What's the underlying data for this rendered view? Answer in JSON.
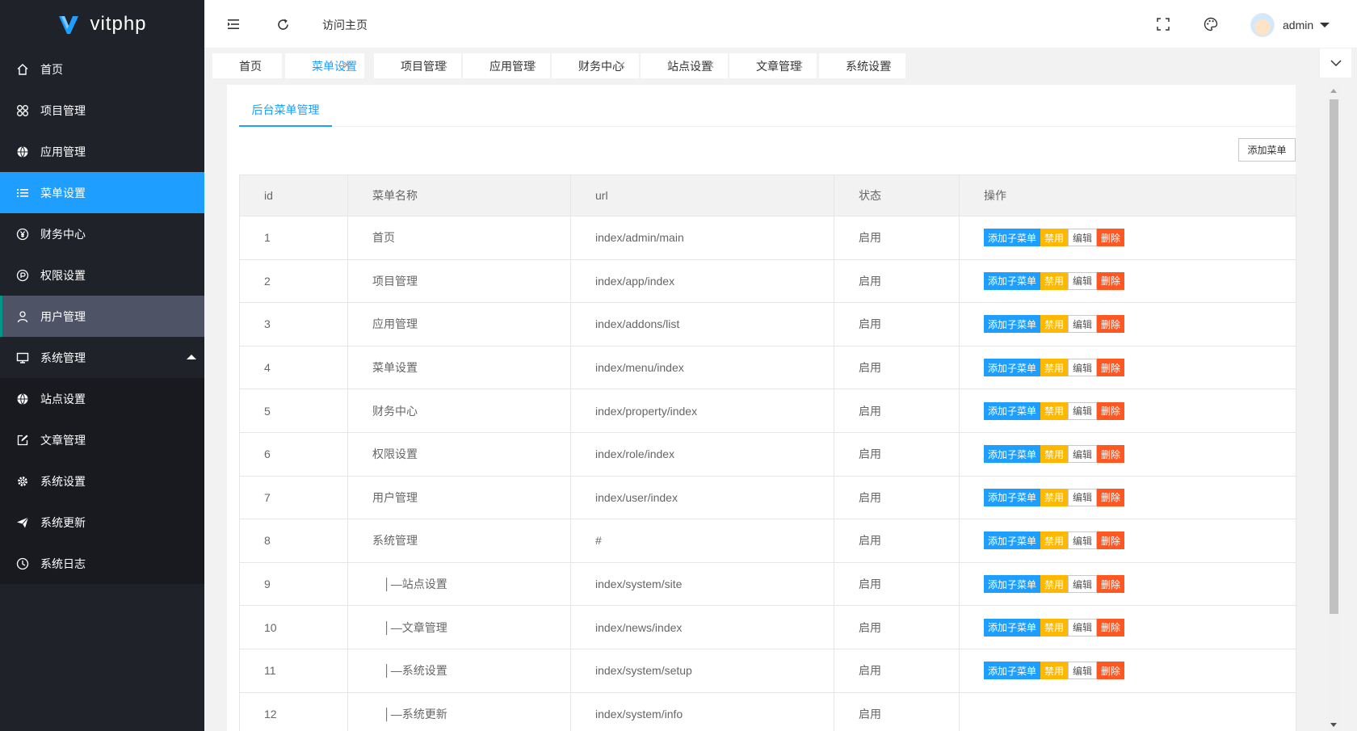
{
  "app": {
    "logo_text": "vitphp"
  },
  "sidebar": {
    "items": [
      {
        "label": "首页",
        "icon": "home-icon",
        "state": "normal"
      },
      {
        "label": "项目管理",
        "icon": "apps-icon",
        "state": "normal"
      },
      {
        "label": "应用管理",
        "icon": "globe-icon",
        "state": "normal"
      },
      {
        "label": "菜单设置",
        "icon": "list-icon",
        "state": "active"
      },
      {
        "label": "财务中心",
        "icon": "yen-icon",
        "state": "normal"
      },
      {
        "label": "权限设置",
        "icon": "key-icon",
        "state": "normal"
      },
      {
        "label": "用户管理",
        "icon": "user-icon",
        "state": "hover"
      },
      {
        "label": "系统管理",
        "icon": "monitor-icon",
        "state": "expanded"
      },
      {
        "label": "站点设置",
        "icon": "globe-icon",
        "state": "child"
      },
      {
        "label": "文章管理",
        "icon": "edit-icon",
        "state": "child"
      },
      {
        "label": "系统设置",
        "icon": "gear-icon",
        "state": "child"
      },
      {
        "label": "系统更新",
        "icon": "send-icon",
        "state": "child"
      },
      {
        "label": "系统日志",
        "icon": "clock-icon",
        "state": "child"
      }
    ]
  },
  "header": {
    "visit_home": "访问主页",
    "user_name": "admin"
  },
  "page_tabs": [
    {
      "label": "首页",
      "closable": false,
      "active": false
    },
    {
      "label": "菜单设置",
      "closable": true,
      "active": true
    },
    {
      "label": "项目管理",
      "closable": true,
      "active": false
    },
    {
      "label": "应用管理",
      "closable": true,
      "active": false
    },
    {
      "label": "财务中心",
      "closable": true,
      "active": false
    },
    {
      "label": "站点设置",
      "closable": true,
      "active": false
    },
    {
      "label": "文章管理",
      "closable": true,
      "active": false
    },
    {
      "label": "系统设置",
      "closable": true,
      "active": false
    }
  ],
  "tab_close_glyph": "✕",
  "content": {
    "subtab": "后台菜单管理",
    "add_button": "添加菜单"
  },
  "table": {
    "headers": [
      "id",
      "菜单名称",
      "url",
      "状态",
      "操作"
    ],
    "actions": [
      "添加子菜单",
      "禁用",
      "编辑",
      "删除"
    ],
    "rows": [
      {
        "id": "1",
        "name": "首页",
        "url": "index/admin/main",
        "status": "启用",
        "has_actions": true
      },
      {
        "id": "2",
        "name": "项目管理",
        "url": "index/app/index",
        "status": "启用",
        "has_actions": true
      },
      {
        "id": "3",
        "name": "应用管理",
        "url": "index/addons/list",
        "status": "启用",
        "has_actions": true
      },
      {
        "id": "4",
        "name": "菜单设置",
        "url": "index/menu/index",
        "status": "启用",
        "has_actions": true
      },
      {
        "id": "5",
        "name": "财务中心",
        "url": "index/property/index",
        "status": "启用",
        "has_actions": true
      },
      {
        "id": "6",
        "name": "权限设置",
        "url": "index/role/index",
        "status": "启用",
        "has_actions": true
      },
      {
        "id": "7",
        "name": "用户管理",
        "url": "index/user/index",
        "status": "启用",
        "has_actions": true
      },
      {
        "id": "8",
        "name": "系统管理",
        "url": "#",
        "status": "启用",
        "has_actions": true
      },
      {
        "id": "9",
        "name": "　│—站点设置",
        "url": "index/system/site",
        "status": "启用",
        "has_actions": true
      },
      {
        "id": "10",
        "name": "　│—文章管理",
        "url": "index/news/index",
        "status": "启用",
        "has_actions": true
      },
      {
        "id": "11",
        "name": "　│—系统设置",
        "url": "index/system/setup",
        "status": "启用",
        "has_actions": true
      },
      {
        "id": "12",
        "name": "　│—系统更新",
        "url": "index/system/info",
        "status": "启用",
        "has_actions": false
      }
    ]
  },
  "colors": {
    "sidebar_bg": "#20222a",
    "accent_blue": "#1e9fff",
    "warn_yellow": "#ffb800",
    "danger_orange": "#ff5722"
  }
}
